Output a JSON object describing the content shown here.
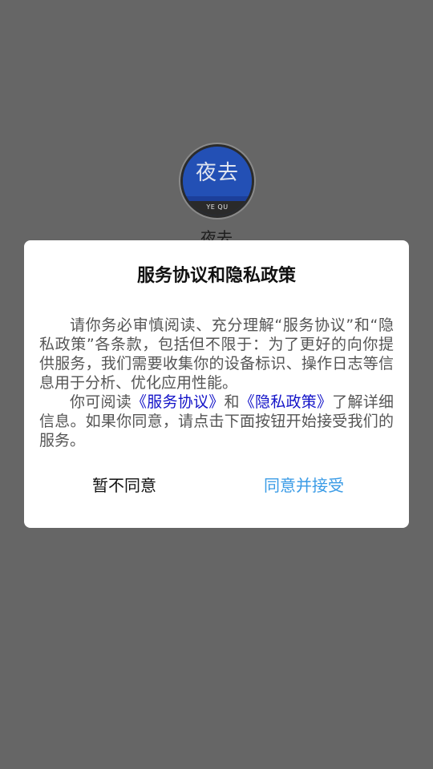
{
  "splash": {
    "logo_main": "夜去",
    "logo_sub": "YE QU",
    "app_name": "夜去"
  },
  "dialog": {
    "title": "服务协议和隐私政策",
    "paragraph1": "请你务必审慎阅读、充分理解“服务协议”和“隐私政策”各条款，包括但不限于：为了更好的向你提供服务，我们需要收集你的设备标识、操作日志等信息用于分析、优化应用性能。",
    "paragraph2": {
      "prefix": "你可阅读",
      "link_service": "《服务协议》",
      "and": "和",
      "link_privacy": "《隐私政策》",
      "suffix": "了解详细信息。如果你同意，请点击下面按钮开始接受我们的服务。"
    },
    "decline_label": "暂不同意",
    "accept_label": "同意并接受"
  },
  "colors": {
    "overlay": "#666666",
    "accent": "#3a9be6",
    "link": "#1313c8"
  }
}
